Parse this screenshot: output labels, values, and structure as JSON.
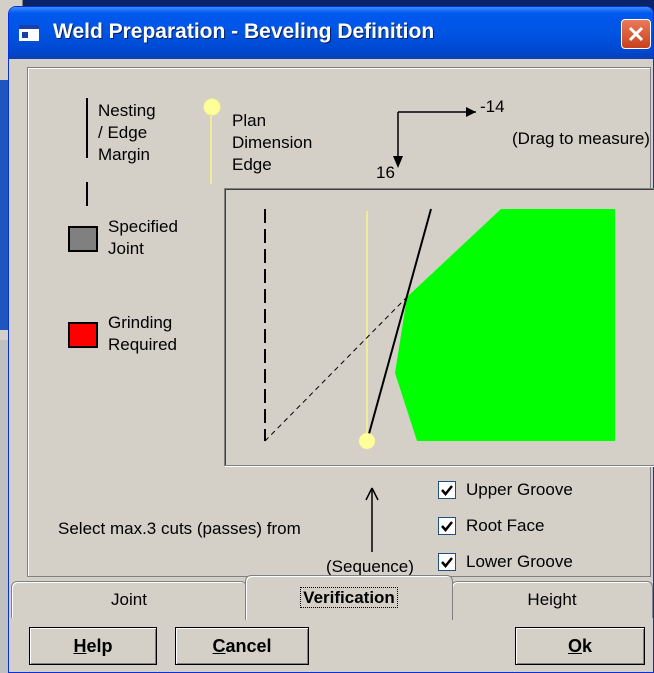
{
  "window": {
    "title": "Weld Preparation - Beveling Definition"
  },
  "legend": {
    "nesting_margin": [
      "Nesting",
      "/ Edge",
      "Margin"
    ],
    "plan_edge": [
      "Plan",
      "Dimension",
      "Edge"
    ],
    "specified_joint": [
      "Specified",
      "Joint"
    ],
    "grinding_required": [
      "Grinding",
      "Required"
    ],
    "specified_joint_color": "#808080",
    "grinding_color": "#ff0000"
  },
  "measure": {
    "x_value": "-14",
    "y_value": "16",
    "hint": "(Drag to measure)"
  },
  "profile": {
    "fill_color": "#00ff00",
    "edge_color": "#ffff99"
  },
  "cuts": {
    "instruction": "Select max.3 cuts (passes) from",
    "sequence_label": "(Sequence)",
    "upper_groove": {
      "label": "Upper Groove",
      "checked": true
    },
    "root_face": {
      "label": "Root Face",
      "checked": true
    },
    "lower_groove": {
      "label": "Lower Groove",
      "checked": true
    }
  },
  "tabs": [
    {
      "label": "Joint",
      "active": false
    },
    {
      "label": "Verification",
      "active": true
    },
    {
      "label": "Height",
      "active": false
    }
  ],
  "buttons": {
    "help": {
      "mnemonic": "H",
      "rest": "elp"
    },
    "cancel": {
      "mnemonic": "C",
      "rest": "ancel"
    },
    "ok": {
      "mnemonic": "O",
      "rest": "k"
    }
  }
}
